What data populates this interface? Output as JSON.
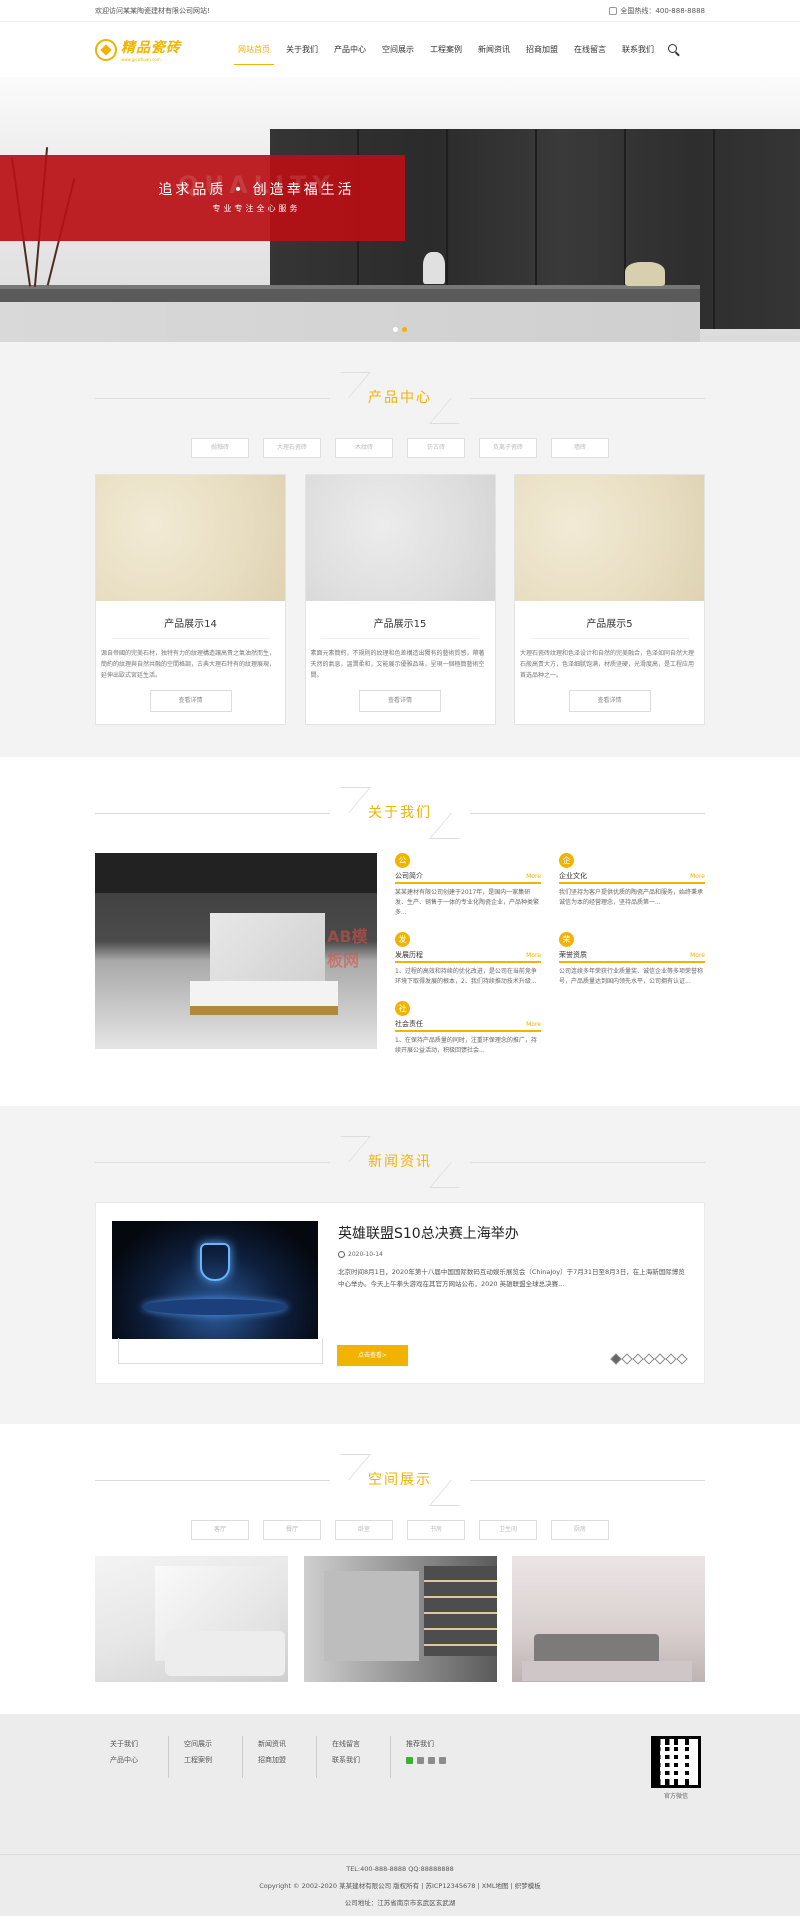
{
  "topbar": {
    "welcome": "欢迎访问某某陶瓷建材有限公司网站!",
    "phone_label": "全国热线：400-888-8888"
  },
  "header": {
    "logo_name": "精品瓷砖",
    "logo_url": "www.jpcizhuan.com",
    "nav": [
      "网站首页",
      "关于我们",
      "产品中心",
      "空间展示",
      "工程案例",
      "新闻资讯",
      "招商加盟",
      "在线留言",
      "联系我们"
    ],
    "active_index": 0
  },
  "banner": {
    "ghost_text": "QUALITY",
    "slogan": "追求品质 • 创造幸福生活",
    "sub": "专业专注全心服务"
  },
  "products": {
    "title": "产品中心",
    "tabs": [
      "抛釉砖",
      "大理石瓷砖",
      "木纹砖",
      "仿古砖",
      "负离子瓷砖",
      "墙砖"
    ],
    "items": [
      {
        "title": "产品展示14",
        "desc": "源自帝國的完美石材，独特有力的紋理構造讓高貴之氣油然而生，簡約的紋理與自然共融的空間格調，古典大理石特有的紋理展現，延伸出歐式宮廷生活。",
        "btn": "查看详情",
        "tone": "beige"
      },
      {
        "title": "产品展示15",
        "desc": "素面元素簡約，不規則的紋理和色差構造出獨有的藝術質感，帶著天然的氣息，溫潤柔和，又能展示優雅品味，呈現一個極簡藝術空間。",
        "btn": "查看详情",
        "tone": "grey"
      },
      {
        "title": "产品展示5",
        "desc": "大理石瓷砖纹理和色泽设计和自然的完美融合，色泽如同自然大理石般高贵大方，色泽细腻饱满，材质坚硬，光滑度高，是工程应用首选品种之一。",
        "btn": "查看详情",
        "tone": "beige"
      }
    ]
  },
  "about": {
    "title": "关于我们",
    "watermark": "AB模板网",
    "items": [
      {
        "icon": "公",
        "name": "公司简介",
        "more": "More",
        "desc": "某某建材有限公司创建于2017年，是国内一家集研发、生产、销售于一体的专业化陶瓷企业，产品种类繁多..."
      },
      {
        "icon": "企",
        "name": "企业文化",
        "more": "More",
        "desc": "我们坚持为客户提供优质的陶瓷产品和服务，始终秉承诚信为本的经营理念，坚持品质第一..."
      },
      {
        "icon": "发",
        "name": "发展历程",
        "more": "More",
        "desc": "1、过程的高效和持续的优化改进，是公司在当前竞争环境下取得发展的根本，2、我们持续推动技术升级..."
      },
      {
        "icon": "荣",
        "name": "荣誉资质",
        "more": "More",
        "desc": "公司连续多年荣获行业质量奖、诚信企业等多项荣誉称号，产品质量达到国内领先水平，公司拥有认证..."
      },
      {
        "icon": "社",
        "name": "社会责任",
        "more": "More",
        "desc": "1、在保持产品质量的同时，注重环保理念的推广，持续开展公益活动，积极回馈社会..."
      }
    ]
  },
  "news": {
    "title": "新闻资讯",
    "headline": "英雄联盟S10总决赛上海举办",
    "date": "2020-10-14",
    "desc": "北京时间8月1日，2020年第十八届中国国际数码互动娱乐展览会（ChinaJoy）于7月31日至8月3日，在上海新国际博览中心举办。今天上午拳头游戏在其官方网站公布，2020 英雄联盟全球总决赛...",
    "btn": "点击查看>",
    "dots": 7,
    "active_dot": 0
  },
  "spaces": {
    "title": "空间展示",
    "tabs": [
      "客厅",
      "餐厅",
      "卧室",
      "书房",
      "卫生间",
      "厨房"
    ]
  },
  "footer": {
    "cols": [
      [
        "关于我们",
        "产品中心"
      ],
      [
        "空间展示",
        "工程案例"
      ],
      [
        "新闻资讯",
        "招商加盟"
      ],
      [
        "在线留言",
        "联系我们"
      ],
      [
        "推荐我们"
      ]
    ],
    "qr_label": "官方微信",
    "copyright": [
      "TEL:400-888-8888    QQ:88888888",
      "Copyright © 2002-2020 某某建材有限公司 版权所有 | 苏ICP12345678 | XML地图 | 织梦模板",
      "公司地址：江苏省南京市玄武区玄武湖"
    ]
  }
}
